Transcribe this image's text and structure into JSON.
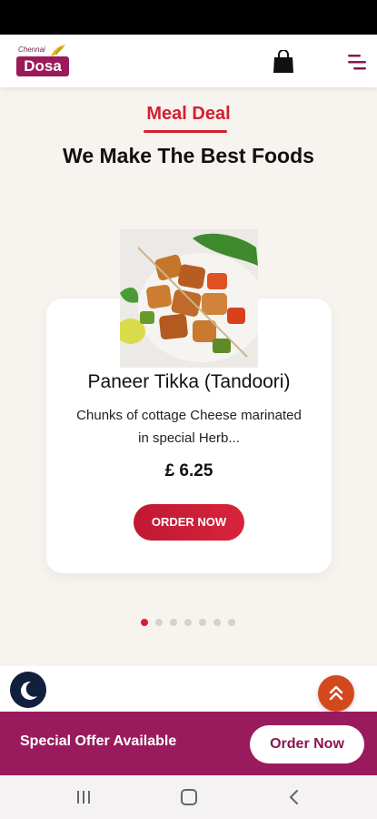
{
  "header": {
    "logo_small": "Chennai",
    "logo_main": "Dosa",
    "icons": [
      "shopping-bag-icon",
      "hamburger-menu-icon"
    ]
  },
  "section": {
    "eyebrow": "Meal Deal",
    "headline": "We Make The Best Foods"
  },
  "product": {
    "name": "Paneer Tikka (Tandoori)",
    "description": "Chunks of cottage Cheese marinated in special Herb...",
    "price": "£ 6.25",
    "order_label": "ORDER NOW"
  },
  "carousel": {
    "total": 7,
    "active_index": 0
  },
  "floating": {
    "left_icon": "dark-mode-moon-icon",
    "right_icon": "scroll-to-top-icon"
  },
  "offer": {
    "text": "Special Offer Available",
    "button": "Order Now"
  },
  "colors": {
    "accent_red": "#d32030",
    "brand_purple": "#9a1b5d",
    "up_button": "#d4481e",
    "moon_button": "#10203d"
  }
}
